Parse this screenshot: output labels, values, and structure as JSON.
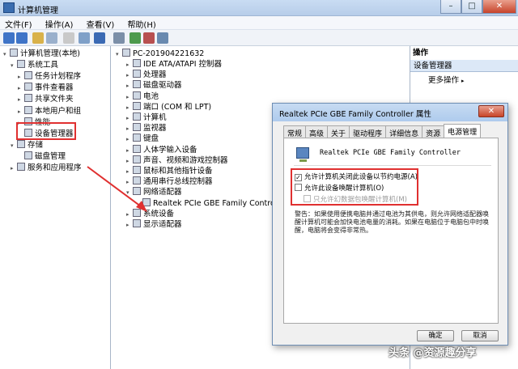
{
  "window": {
    "title": "计算机管理"
  },
  "menu": [
    "文件(F)",
    "操作(A)",
    "查看(V)",
    "帮助(H)"
  ],
  "left_tree": [
    {
      "label": "计算机管理(本地)",
      "indent": 0,
      "exp": "▾"
    },
    {
      "label": "系统工具",
      "indent": 1,
      "exp": "▾"
    },
    {
      "label": "任务计划程序",
      "indent": 2,
      "exp": "▸"
    },
    {
      "label": "事件查看器",
      "indent": 2,
      "exp": "▸"
    },
    {
      "label": "共享文件夹",
      "indent": 2,
      "exp": "▸"
    },
    {
      "label": "本地用户和组",
      "indent": 2,
      "exp": "▸"
    },
    {
      "label": "性能",
      "indent": 2,
      "exp": "▸"
    },
    {
      "label": "设备管理器",
      "indent": 2,
      "exp": ""
    },
    {
      "label": "存储",
      "indent": 1,
      "exp": "▾"
    },
    {
      "label": "磁盘管理",
      "indent": 2,
      "exp": ""
    },
    {
      "label": "服务和应用程序",
      "indent": 1,
      "exp": "▸"
    }
  ],
  "device_tree": {
    "root": "PC-201904221632",
    "items": [
      "IDE ATA/ATAPI 控制器",
      "处理器",
      "磁盘驱动器",
      "电池",
      "端口 (COM 和 LPT)",
      "计算机",
      "监视器",
      "键盘",
      "人体学输入设备",
      "声音、视频和游戏控制器",
      "鼠标和其他指针设备",
      "通用串行总线控制器",
      "网络适配器",
      "Realtek PCIe GBE Family Controller",
      "系统设备",
      "显示适配器"
    ]
  },
  "actions": {
    "header": "操作",
    "selected": "设备管理器",
    "more": "更多操作"
  },
  "dialog": {
    "title": "Realtek PCIe GBE Family Controller 属性",
    "close": "✕",
    "tabs": [
      "常规",
      "高级",
      "关于",
      "驱动程序",
      "详细信息",
      "资源",
      "电源管理"
    ],
    "device_name": "Realtek PCIe GBE Family Controller",
    "options": [
      {
        "label": "允许计算机关闭此设备以节约电源(A)",
        "checked": true,
        "disabled": false
      },
      {
        "label": "允许此设备唤醒计算机(O)",
        "checked": false,
        "disabled": false
      },
      {
        "label": "只允许幻数据包唤醒计算机(M)",
        "checked": false,
        "disabled": true
      }
    ],
    "warning": "警告：如果使用便携电脑并通过电池为其供电，则允许网络适配器唤醒计算机可能会加快电池电量的消耗。如果在电脑位于电脑包中时唤醒，电脑将会变得非常热。",
    "ok": "确定",
    "cancel": "取消"
  },
  "watermark": "头条 @资源趣分享",
  "colors": {
    "highlight": "#e03030",
    "titlebar": "#b7cde9"
  }
}
